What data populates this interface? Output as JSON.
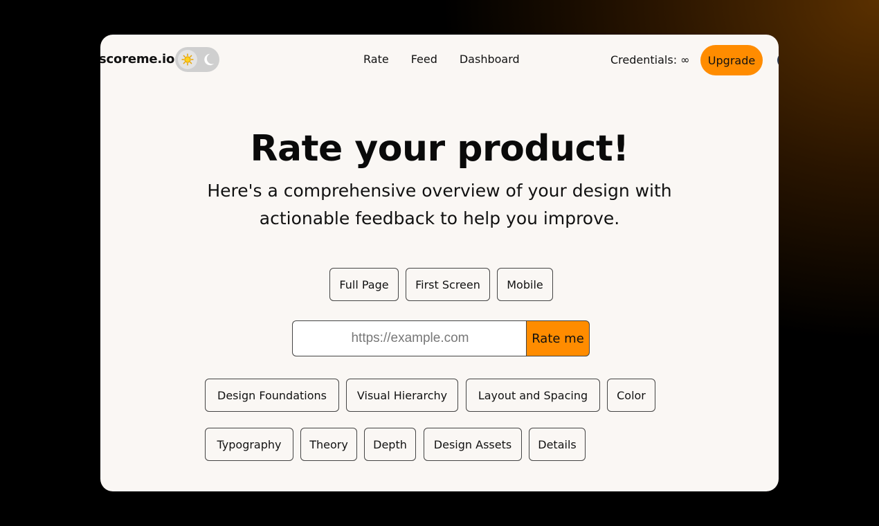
{
  "brand": {
    "name": "scoreme.io",
    "accent_color": "#ff8c00"
  },
  "theme_toggle": {
    "icons": [
      "sun-icon",
      "moon-icon"
    ]
  },
  "nav": {
    "links": [
      "Rate",
      "Feed",
      "Dashboard"
    ],
    "credentials": "Credentials: ∞",
    "upgrade_label": "Upgrade"
  },
  "hero": {
    "title": "Rate your product!",
    "subtitle_line1": "Here's a comprehensive overview of your design with",
    "subtitle_line2": "actionable feedback to help you improve."
  },
  "modes": [
    "Full Page",
    "First Screen",
    "Mobile"
  ],
  "url_form": {
    "placeholder": "https://example.com",
    "value": "",
    "submit_label": "Rate me"
  },
  "categories": {
    "row1": [
      "Design Foundations",
      "Visual Hierarchy",
      "Layout and Spacing",
      "Color"
    ],
    "row2": [
      "Typography",
      "Theory",
      "Depth",
      "Design Assets",
      "Details"
    ]
  }
}
